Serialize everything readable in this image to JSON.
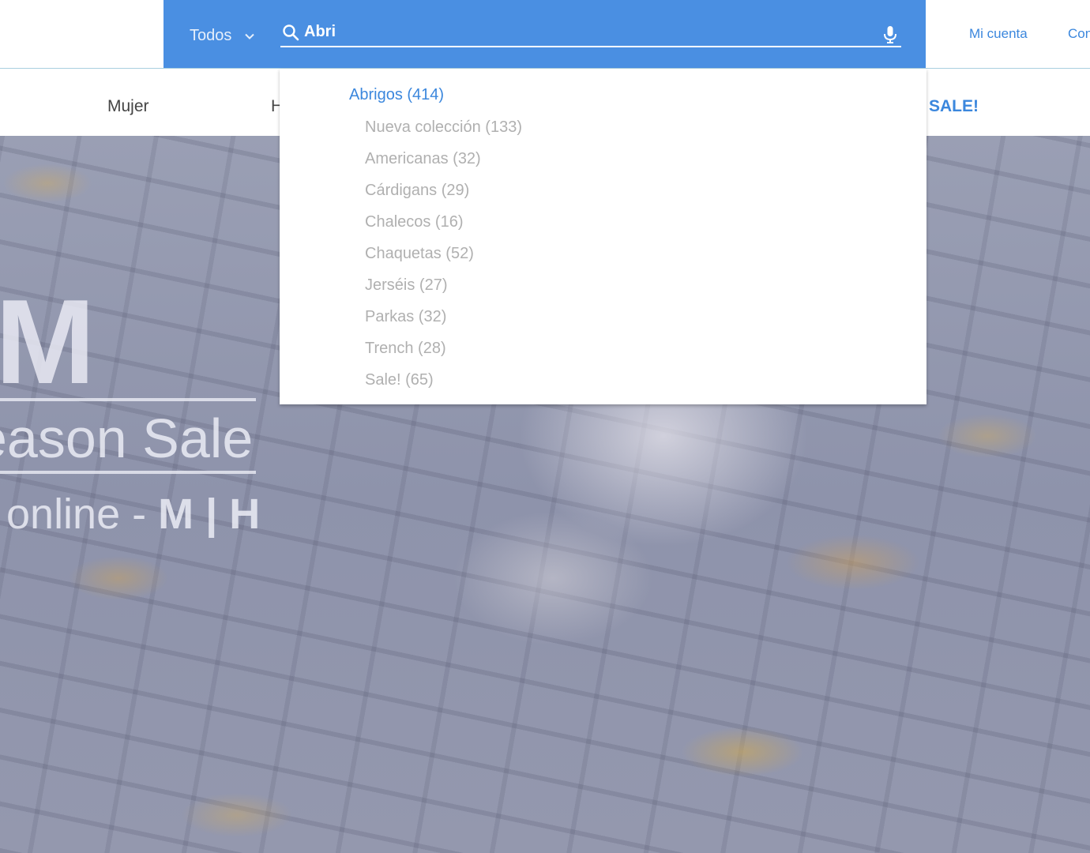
{
  "header": {
    "department_select": "Todos",
    "search": {
      "value": "Abri",
      "placeholder": ""
    },
    "account_link": "Mi cuenta",
    "contact_link": "Con"
  },
  "nav": {
    "items": [
      "Mujer",
      "H"
    ],
    "sale": "SALE!"
  },
  "suggestions": {
    "heading": "Abrigos (414)",
    "items": [
      "Nueva colección (133)",
      "Americanas (32)",
      "Cárdigans (29)",
      "Chalecos (16)",
      "Chaquetas (52)",
      "Jerséis (27)",
      "Parkas (32)",
      "Trench (28)",
      "Sale! (65)"
    ]
  },
  "hero": {
    "big_letter": "M",
    "season": "eason Sale",
    "online_prefix": "online - ",
    "online_bold": "M | H"
  },
  "colors": {
    "accent": "#4a8fe2",
    "link": "#3b87dd",
    "muted": "#b0b0b0"
  },
  "icons": [
    "chevron-down-icon",
    "search-icon",
    "microphone-icon"
  ]
}
